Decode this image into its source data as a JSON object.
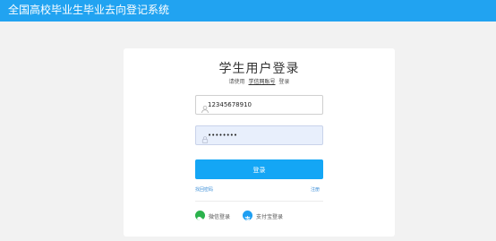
{
  "header": {
    "title": "全国高校毕业生毕业去向登记系统"
  },
  "login": {
    "title": "学生用户登录",
    "subtitle_prefix": "请使用",
    "subtitle_link": "学信网账号",
    "subtitle_suffix": "登录",
    "username_value": "12345678910",
    "password_value": "••••••••",
    "login_button": "登录",
    "forgot_link": "找回密码",
    "register_link": "注册",
    "wechat_label": "微信登录",
    "alipay_label": "支付宝登录"
  },
  "colors": {
    "header_bg": "#21a3f1",
    "button_bg": "#14a6f5",
    "wechat": "#2bb24c",
    "alipay": "#1e9ff2"
  },
  "icons": {
    "user": "user-icon",
    "lock": "lock-icon",
    "wechat": "wechat-icon",
    "alipay": "alipay-icon"
  }
}
